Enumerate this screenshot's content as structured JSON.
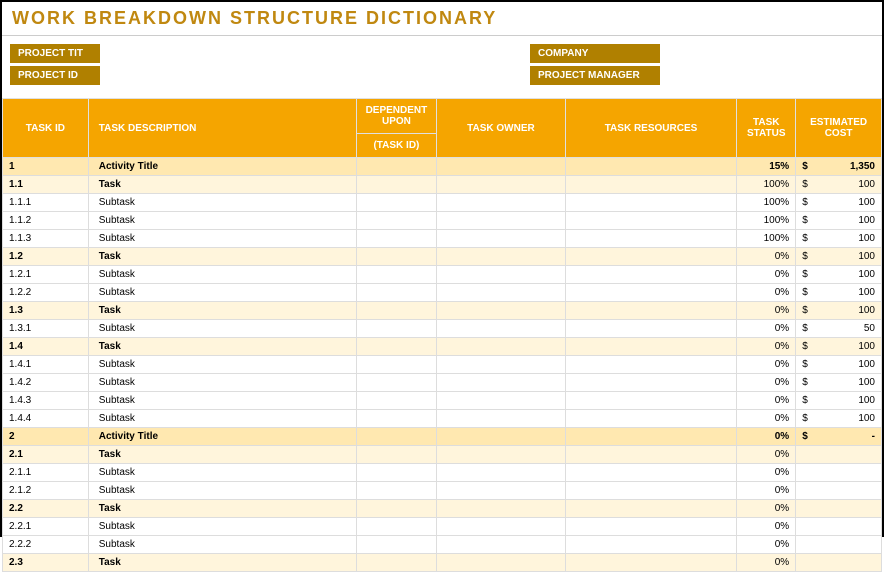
{
  "title": "WORK BREAKDOWN STRUCTURE DICTIONARY",
  "meta": {
    "project_title_label": "PROJECT TIT",
    "project_title_value": "",
    "project_id_label": "PROJECT ID",
    "project_id_value": "",
    "company_label": "COMPANY",
    "company_value": "",
    "pm_label": "PROJECT MANAGER",
    "pm_value": ""
  },
  "columns": {
    "task_id": "TASK ID",
    "task_desc": "TASK DESCRIPTION",
    "dep_upon": "DEPENDENT UPON",
    "dep_sub": "(TASK ID)",
    "task_owner": "TASK OWNER",
    "task_res": "TASK RESOURCES",
    "task_status": "TASK STATUS",
    "est_cost": "ESTIMATED COST"
  },
  "rows": [
    {
      "type": "activity",
      "id": "1",
      "desc": "Activity Title",
      "status": "15%",
      "cost": "1,350"
    },
    {
      "type": "task",
      "id": "1.1",
      "desc": "Task",
      "status": "100%",
      "cost": "100"
    },
    {
      "type": "subtask",
      "id": "1.1.1",
      "desc": "Subtask",
      "status": "100%",
      "cost": "100"
    },
    {
      "type": "subtask",
      "id": "1.1.2",
      "desc": "Subtask",
      "status": "100%",
      "cost": "100"
    },
    {
      "type": "subtask",
      "id": "1.1.3",
      "desc": "Subtask",
      "status": "100%",
      "cost": "100"
    },
    {
      "type": "task",
      "id": "1.2",
      "desc": "Task",
      "status": "0%",
      "cost": "100"
    },
    {
      "type": "subtask",
      "id": "1.2.1",
      "desc": "Subtask",
      "status": "0%",
      "cost": "100"
    },
    {
      "type": "subtask",
      "id": "1.2.2",
      "desc": "Subtask",
      "status": "0%",
      "cost": "100"
    },
    {
      "type": "task",
      "id": "1.3",
      "desc": "Task",
      "status": "0%",
      "cost": "100"
    },
    {
      "type": "subtask",
      "id": "1.3.1",
      "desc": "Subtask",
      "status": "0%",
      "cost": "50"
    },
    {
      "type": "task",
      "id": "1.4",
      "desc": "Task",
      "status": "0%",
      "cost": "100"
    },
    {
      "type": "subtask",
      "id": "1.4.1",
      "desc": "Subtask",
      "status": "0%",
      "cost": "100"
    },
    {
      "type": "subtask",
      "id": "1.4.2",
      "desc": "Subtask",
      "status": "0%",
      "cost": "100"
    },
    {
      "type": "subtask",
      "id": "1.4.3",
      "desc": "Subtask",
      "status": "0%",
      "cost": "100"
    },
    {
      "type": "subtask",
      "id": "1.4.4",
      "desc": "Subtask",
      "status": "0%",
      "cost": "100"
    },
    {
      "type": "activity",
      "id": "2",
      "desc": "Activity Title",
      "status": "0%",
      "cost": "-"
    },
    {
      "type": "task",
      "id": "2.1",
      "desc": "Task",
      "status": "0%",
      "cost": ""
    },
    {
      "type": "subtask",
      "id": "2.1.1",
      "desc": "Subtask",
      "status": "0%",
      "cost": ""
    },
    {
      "type": "subtask",
      "id": "2.1.2",
      "desc": "Subtask",
      "status": "0%",
      "cost": ""
    },
    {
      "type": "task",
      "id": "2.2",
      "desc": "Task",
      "status": "0%",
      "cost": ""
    },
    {
      "type": "subtask",
      "id": "2.2.1",
      "desc": "Subtask",
      "status": "0%",
      "cost": ""
    },
    {
      "type": "subtask",
      "id": "2.2.2",
      "desc": "Subtask",
      "status": "0%",
      "cost": ""
    },
    {
      "type": "task",
      "id": "2.3",
      "desc": "Task",
      "status": "0%",
      "cost": ""
    }
  ],
  "currency": "$"
}
